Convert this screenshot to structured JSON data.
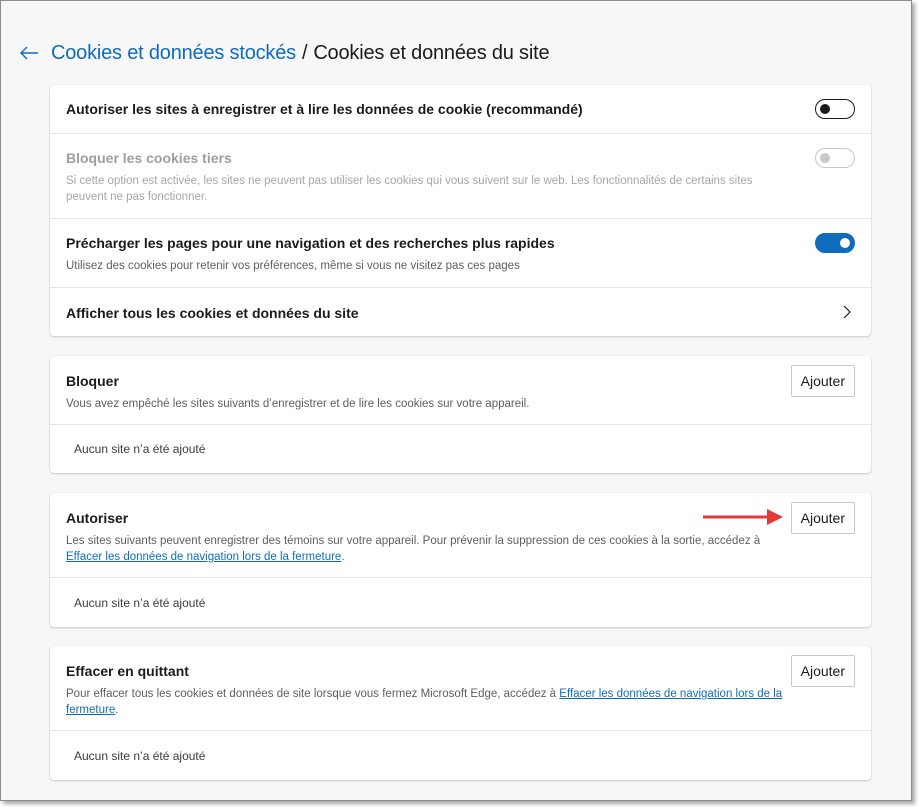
{
  "breadcrumb": {
    "parent": "Cookies et données stockés",
    "separator": "/",
    "current": "Cookies et données du site"
  },
  "settings": {
    "allow_cookies": {
      "title": "Autoriser les sites à enregistrer et à lire les données de cookie (recommandé)",
      "state": "off"
    },
    "block_third_party": {
      "title": "Bloquer les cookies tiers",
      "desc": "Si cette option est activée, les sites ne peuvent pas utiliser les cookies qui vous suivent sur le web. Les fonctionnalités de certains sites peuvent ne pas fonctionner.",
      "state": "disabled"
    },
    "preload": {
      "title": "Précharger les pages pour une navigation et des recherches plus rapides",
      "desc": "Utilisez des cookies pour retenir vos préférences, même si vous ne visitez pas ces pages",
      "state": "on"
    },
    "see_all": {
      "title": "Afficher tous les cookies et données du site"
    }
  },
  "block": {
    "title": "Bloquer",
    "desc": "Vous avez empêché les sites suivants d’enregistrer et de lire les cookies sur votre appareil.",
    "button": "Ajouter",
    "empty": "Aucun site n’a été ajouté"
  },
  "allow": {
    "title": "Autoriser",
    "desc": "Les sites suivants peuvent enregistrer des témoins sur votre appareil. Pour prévenir la suppression de ces cookies à la sortie, accédez à",
    "link": "Effacer les données de navigation lors de la fermeture",
    "link_suffix": ".",
    "button": "Ajouter",
    "empty": "Aucun site n’a été ajouté"
  },
  "clear_on_exit": {
    "title": "Effacer en quittant",
    "desc": "Pour effacer tous les cookies et données de site lorsque vous fermez Microsoft Edge, accédez à",
    "link": "Effacer les données de navigation lors de la fermeture",
    "link_suffix": ".",
    "button": "Ajouter",
    "empty": "Aucun site n’a été ajouté"
  },
  "colors": {
    "accent": "#0f6cbd",
    "annotation_arrow": "#e53935"
  },
  "icons": {
    "back": "arrow-left-icon",
    "chevron": "chevron-right-icon",
    "annotation": "red-arrow-icon"
  }
}
